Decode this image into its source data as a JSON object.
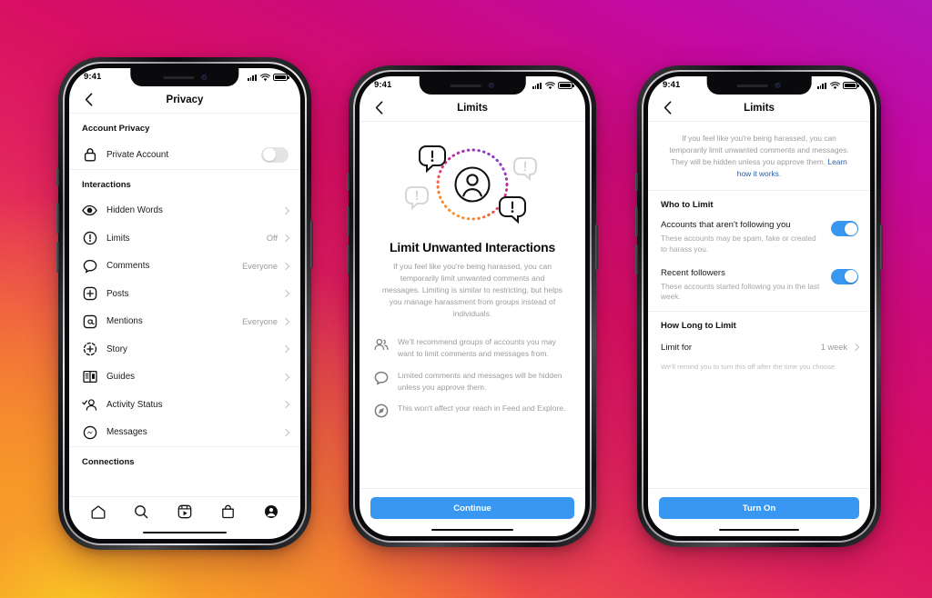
{
  "background": {
    "colors": [
      "#f9d423",
      "#f89b1c",
      "#ed4a4a",
      "#d80f63",
      "#c209a3",
      "#b415b8"
    ]
  },
  "accent": {
    "blue": "#3897f0",
    "link": "#2b5fa8",
    "toggle_off": "#e4e4e6"
  },
  "phones": [
    {
      "id": "phone-privacy",
      "status_bar": {
        "time": "9:41",
        "signal_icon": "cellular-bars-icon",
        "wifi_icon": "wifi-icon",
        "battery_icon": "battery-icon"
      },
      "navbar": {
        "back_icon": "chevron-left-icon",
        "title": "Privacy"
      },
      "sections": [
        {
          "header": "Account Privacy",
          "rows": [
            {
              "icon": "lock-icon",
              "label": "Private Account",
              "control": "toggle",
              "state": "off"
            }
          ]
        },
        {
          "header": "Interactions",
          "rows": [
            {
              "icon": "eye-icon",
              "label": "Hidden Words",
              "value": "",
              "control": "chevron"
            },
            {
              "icon": "exclamation-circle-icon",
              "label": "Limits",
              "value": "Off",
              "control": "chevron"
            },
            {
              "icon": "comment-icon",
              "label": "Comments",
              "value": "Everyone",
              "control": "chevron"
            },
            {
              "icon": "plus-square-icon",
              "label": "Posts",
              "value": "",
              "control": "chevron"
            },
            {
              "icon": "at-square-icon",
              "label": "Mentions",
              "value": "Everyone",
              "control": "chevron"
            },
            {
              "icon": "story-plus-icon",
              "label": "Story",
              "value": "",
              "control": "chevron"
            },
            {
              "icon": "guides-book-icon",
              "label": "Guides",
              "value": "",
              "control": "chevron"
            },
            {
              "icon": "person-check-icon",
              "label": "Activity Status",
              "value": "",
              "control": "chevron"
            },
            {
              "icon": "messenger-icon",
              "label": "Messages",
              "value": "",
              "control": "chevron"
            }
          ]
        },
        {
          "header": "Connections",
          "rows": []
        }
      ],
      "tabbar": [
        {
          "icon": "home-icon",
          "name": "tab-home"
        },
        {
          "icon": "search-icon",
          "name": "tab-search"
        },
        {
          "icon": "reels-icon",
          "name": "tab-reels"
        },
        {
          "icon": "shop-bag-icon",
          "name": "tab-shop"
        },
        {
          "icon": "profile-icon",
          "name": "tab-profile"
        }
      ]
    },
    {
      "id": "phone-limits-intro",
      "status_bar": {
        "time": "9:41"
      },
      "navbar": {
        "back_icon": "chevron-left-icon",
        "title": "Limits"
      },
      "hero": {
        "illustration": "user-in-dotted-circle-with-alert-bubbles",
        "title": "Limit Unwanted Interactions",
        "body": "If you feel like you're being harassed, you can temporarily limit unwanted comments and messages. Limiting is similar to restricting, but helps you manage harassment from groups instead of individuals."
      },
      "bullets": [
        {
          "icon": "group-people-icon",
          "text": "We'll recommend groups of accounts you may want to limit comments and messages from."
        },
        {
          "icon": "comment-icon",
          "text": "Limited comments and messages will be hidden unless you approve them."
        },
        {
          "icon": "compass-icon",
          "text": "This won't affect your reach in Feed and Explore."
        }
      ],
      "cta": {
        "label": "Continue"
      }
    },
    {
      "id": "phone-limits-settings",
      "status_bar": {
        "time": "9:41"
      },
      "navbar": {
        "back_icon": "chevron-left-icon",
        "title": "Limits"
      },
      "intro": {
        "text": "If you feel like you're being harassed, you can temporarily limit unwanted comments and messages. They will be hidden unless you approve them. ",
        "link": "Learn how it works",
        "suffix": "."
      },
      "who_to_limit": {
        "header": "Who to Limit",
        "rows": [
          {
            "title": "Accounts that aren't following you",
            "subtitle": "These accounts may be spam, fake or created to harass you.",
            "state": "on"
          },
          {
            "title": "Recent followers",
            "subtitle": "These accounts started following you in the last week.",
            "state": "on"
          }
        ]
      },
      "how_long": {
        "header": "How Long to Limit",
        "row": {
          "label": "Limit for",
          "value": "1 week"
        },
        "note": "We'll remind you to turn this off after the time you choose."
      },
      "cta": {
        "label": "Turn On"
      }
    }
  ]
}
